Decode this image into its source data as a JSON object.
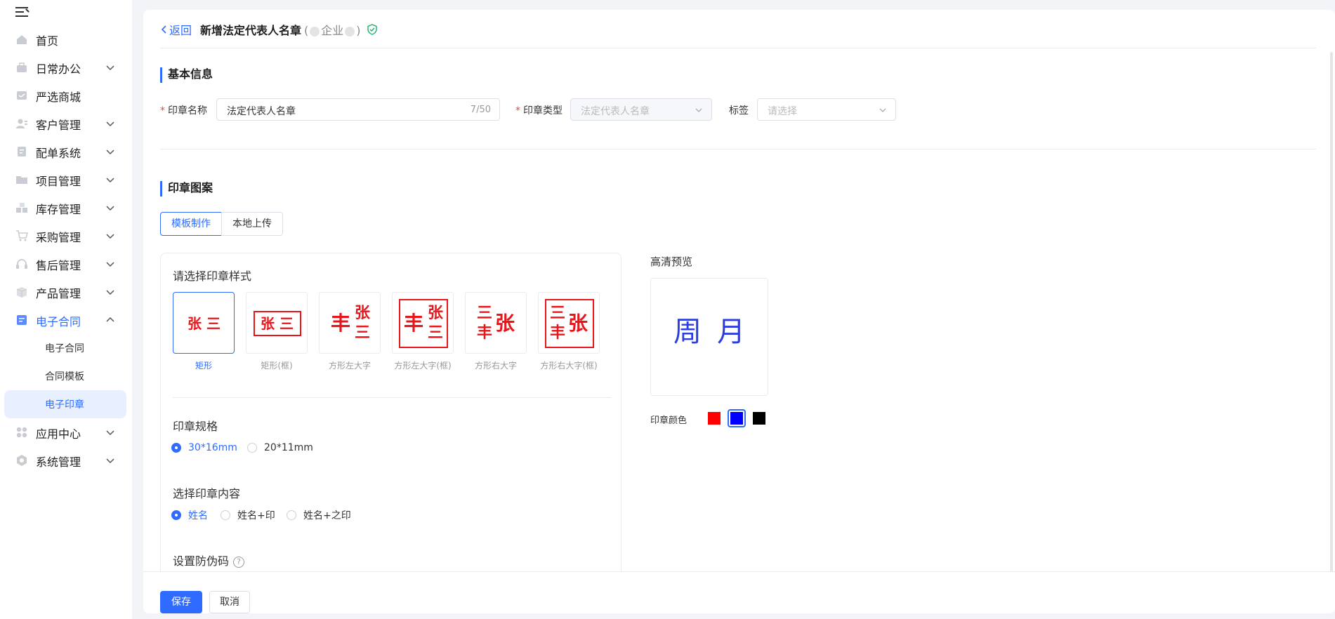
{
  "sidebar": {
    "items": [
      {
        "label": "首页",
        "icon": "home-icon"
      },
      {
        "label": "日常办公",
        "icon": "briefcase-icon"
      },
      {
        "label": "严选商城",
        "icon": "shop-icon"
      },
      {
        "label": "客户管理",
        "icon": "user-icon"
      },
      {
        "label": "配单系统",
        "icon": "document-icon"
      },
      {
        "label": "项目管理",
        "icon": "folder-icon"
      },
      {
        "label": "库存管理",
        "icon": "boxes-icon"
      },
      {
        "label": "采购管理",
        "icon": "cart-icon"
      },
      {
        "label": "售后管理",
        "icon": "headset-icon"
      },
      {
        "label": "产品管理",
        "icon": "cube-icon"
      },
      {
        "label": "电子合同",
        "icon": "contract-icon"
      },
      {
        "label": "应用中心",
        "icon": "apps-icon"
      },
      {
        "label": "系统管理",
        "icon": "settings-icon"
      }
    ],
    "sub_items": [
      "电子合同",
      "合同模板",
      "电子印章"
    ]
  },
  "header": {
    "back_label": "返回",
    "title": "新增法定代表人名章",
    "subtitle_open": "(",
    "subtitle_company": "企业",
    "subtitle_close": ")"
  },
  "basic_info": {
    "section_title": "基本信息",
    "seal_name_label": "印章名称",
    "seal_name_value": "法定代表人名章",
    "seal_name_count": "7/50",
    "seal_type_label": "印章类型",
    "seal_type_value": "法定代表人名章",
    "tag_label": "标签",
    "tag_placeholder": "请选择"
  },
  "seal_pattern": {
    "section_title": "印章图案",
    "tabs": [
      "模板制作",
      "本地上传"
    ],
    "style_prompt": "请选择印章样式",
    "styles": [
      "矩形",
      "矩形(框)",
      "方形左大字",
      "方形左大字(框)",
      "方形右大字",
      "方形右大字(框)"
    ],
    "sample_text": {
      "name_full": "张 三",
      "zhang": "张",
      "san": "三",
      "feng": "丰"
    },
    "spec_label": "印章规格",
    "spec_options": [
      "30*16mm",
      "20*11mm"
    ],
    "content_label": "选择印章内容",
    "content_options": [
      "姓名",
      "姓名+印",
      "姓名+之印"
    ],
    "anti_fake_label": "设置防伪码",
    "help_mark": "?"
  },
  "preview": {
    "title": "高清预览",
    "chars": [
      "周",
      "月"
    ],
    "color_label": "印章颜色",
    "colors": [
      "#ff0000",
      "#0000ff",
      "#000000"
    ],
    "selected_color": "#0000ff"
  },
  "footer": {
    "save_label": "保存",
    "cancel_label": "取消"
  }
}
